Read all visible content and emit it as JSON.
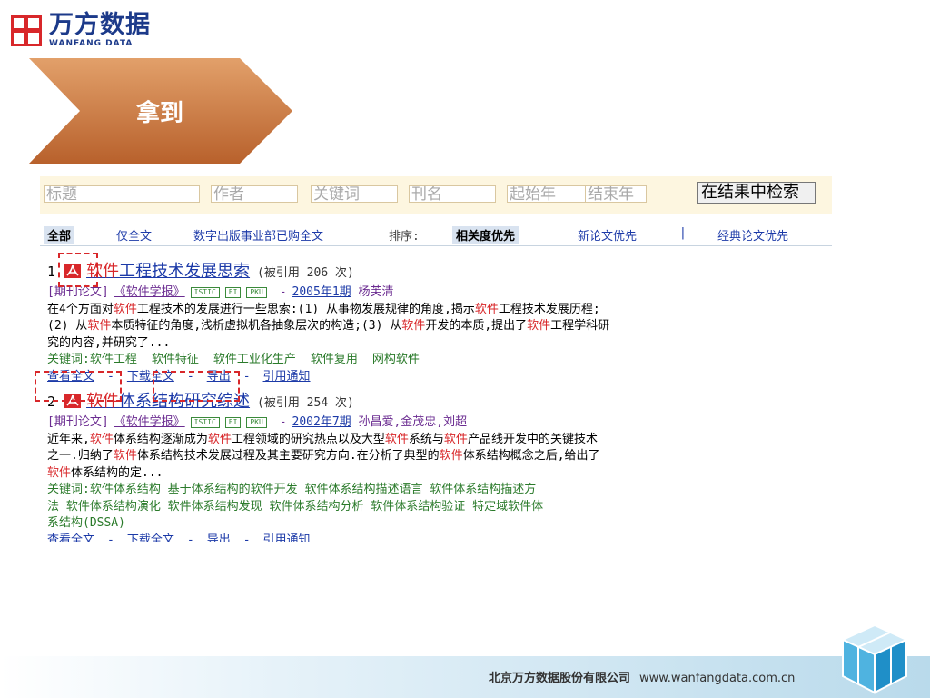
{
  "logo": {
    "cn": "万方数据",
    "en": "WANFANG DATA"
  },
  "banner": {
    "label": "拿到"
  },
  "search": {
    "title_ph": "标题",
    "author_ph": "作者",
    "keyword_ph": "关键词",
    "journal_ph": "刊名",
    "start_year_ph": "起始年",
    "dash": "-",
    "end_year_ph": "结束年",
    "button": "在结果中检索"
  },
  "filters": {
    "all": "全部",
    "fulltext": "仅全文",
    "purchased": "数字出版事业部已购全文",
    "sort_label": "排序:",
    "relevance": "相关度优先",
    "newest": "新论文优先",
    "divider": "|",
    "classic": "经典论文优先"
  },
  "results": [
    {
      "num": "1",
      "title_hl1": "软件",
      "title_rest": "工程技术发展思索",
      "cited": "(被引用 206 次)",
      "type": "[期刊论文]",
      "journal": "《软件学报》",
      "tags": [
        "ISTIC",
        "EI",
        "PKU"
      ],
      "dash": "-",
      "issue": "2005年1期",
      "authors": "杨芙清",
      "abstract": [
        [
          "在4个方面对",
          "软件",
          "工程技术的发展进行一些思索:(1) 从事物发展规律的角度,揭示",
          "软件",
          "工程技术发展历程;"
        ],
        [
          "(2) 从",
          "软件",
          "本质特征的角度,浅析虚拟机各抽象层次的构造;(3) 从",
          "软件",
          "开发的本质,提出了",
          "软件",
          "工程学科研"
        ],
        [
          "究的内容,并研究了..."
        ]
      ],
      "keywords_label": "关键词:",
      "keywords": [
        "软件工程",
        "软件特征",
        "软件工业化生产",
        "软件复用",
        "网构软件"
      ],
      "actions": {
        "view": "查看全文",
        "download": "下载全文",
        "export": "导出",
        "notify": "引用通知",
        "sep": "-"
      }
    },
    {
      "num": "2",
      "title_hl1": "软件",
      "title_rest": "体系结构研究综述",
      "cited": "(被引用 254 次)",
      "type": "[期刊论文]",
      "journal": "《软件学报》",
      "tags": [
        "ISTIC",
        "EI",
        "PKU"
      ],
      "dash": "-",
      "issue": "2002年7期",
      "authors": "孙昌爱,金茂忠,刘超",
      "abstract": [
        [
          "近年来,",
          "软件",
          "体系结构逐渐成为",
          "软件",
          "工程领域的研究热点以及大型",
          "软件",
          "系统与",
          "软件",
          "产品线开发中的关键技术"
        ],
        [
          "之一.归纳了",
          "软件",
          "体系结构技术发展过程及其主要研究方向.在分析了典型的",
          "软件",
          "体系结构概念之后,给出了"
        ],
        [
          "",
          "软件",
          "体系结构的定..."
        ]
      ],
      "keywords_label": "关键词:",
      "keywords_lines": [
        "关键词:软件体系结构    基于体系结构的软件开发    软件体系结构描述语言    软件体系结构描述方",
        "法    软件体系结构演化    软件体系结构发现    软件体系结构分析    软件体系结构验证    特定域软件体",
        "系结构(DSSA)"
      ],
      "actions": {
        "view": "查看全文",
        "download": "下载全文",
        "export": "导出",
        "notify": "引用通知",
        "sep": "-"
      }
    }
  ],
  "footer": {
    "company": "北京万方数据股份有限公司",
    "url": "www.wanfangdata.com.cn"
  },
  "colors": {
    "brand": "#1c3a8a",
    "highlight": "#d8272a",
    "link": "#1c3aa8",
    "arrow": "#c8733a"
  }
}
